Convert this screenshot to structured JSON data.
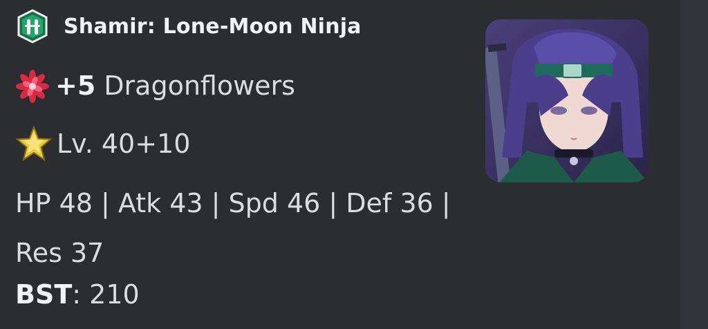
{
  "embed": {
    "author_name": "Shamir: Lone-Moon Ninja",
    "dragonflowers": {
      "count": "+5",
      "label": "Dragonflowers"
    },
    "level": {
      "text": "Lv. 40+10"
    },
    "stats_text": "HP 48 | Atk 43 | Spd 46 | Def 36 | Res 37",
    "bst": {
      "label": "BST",
      "separator": ":",
      "value": "210"
    },
    "icons": {
      "author": "infantry-weapon-emblem-icon",
      "dragonflower": "dragonflower-icon",
      "level": "star-rarity-icon",
      "thumbnail": "hero-portrait-thumbnail"
    },
    "colors": {
      "background": "#2b2d31",
      "text": "#dbdee1",
      "heading": "#f2f3f5",
      "emblem_green": "#1f8a5b",
      "star_gold": "#e8c43a",
      "flower_red": "#e0354c"
    }
  }
}
